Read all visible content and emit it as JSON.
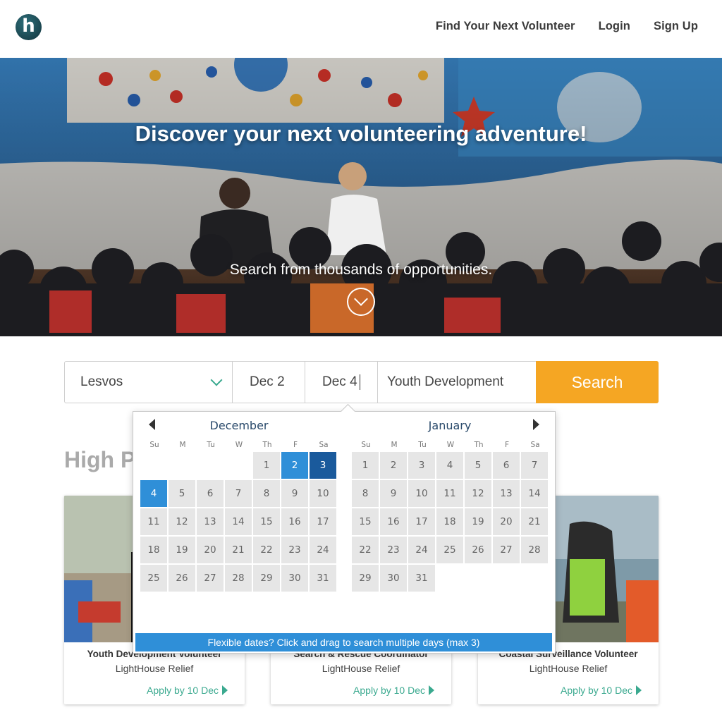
{
  "header": {
    "logo_letter": "h",
    "nav": [
      "Find Your Next Volunteer",
      "Login",
      "Sign Up"
    ]
  },
  "hero": {
    "title": "Discover your next volunteering adventure!",
    "subtitle": "Search from thousands of opportunities."
  },
  "search": {
    "location": "Lesvos",
    "start_date": "Dec 2",
    "end_date": "Dec 4",
    "category": "Youth Development",
    "button_label": "Search"
  },
  "section_title": "High P",
  "calendar": {
    "months": [
      {
        "name": "December",
        "weekdays": [
          "Su",
          "M",
          "Tu",
          "W",
          "Th",
          "F",
          "Sa"
        ],
        "first_weekday": 4,
        "days": 31,
        "selected": {
          "start": 2,
          "mid": [
            3
          ],
          "end": 4
        }
      },
      {
        "name": "January",
        "weekdays": [
          "Su",
          "M",
          "Tu",
          "W",
          "Th",
          "F",
          "Sa"
        ],
        "first_weekday": 0,
        "days": 31
      }
    ],
    "flex_hint": "Flexible dates? Click and drag to search multiple days (max 3)"
  },
  "cards": [
    {
      "title": "Youth Development Volunteer",
      "org": "LightHouse Relief",
      "apply": "Apply by 10 Dec"
    },
    {
      "title": "Search & Rescue Coordinator",
      "org": "LightHouse Relief",
      "apply": "Apply by 10 Dec"
    },
    {
      "title": "Coastal Surveillance Volunteer",
      "org": "LightHouse Relief",
      "apply": "Apply by 10 Dec"
    }
  ],
  "colors": {
    "accent_orange": "#f5a623",
    "accent_teal": "#3aa98f",
    "calendar_blue": "#2f8fd8",
    "calendar_dark_blue": "#1a5a9c"
  }
}
